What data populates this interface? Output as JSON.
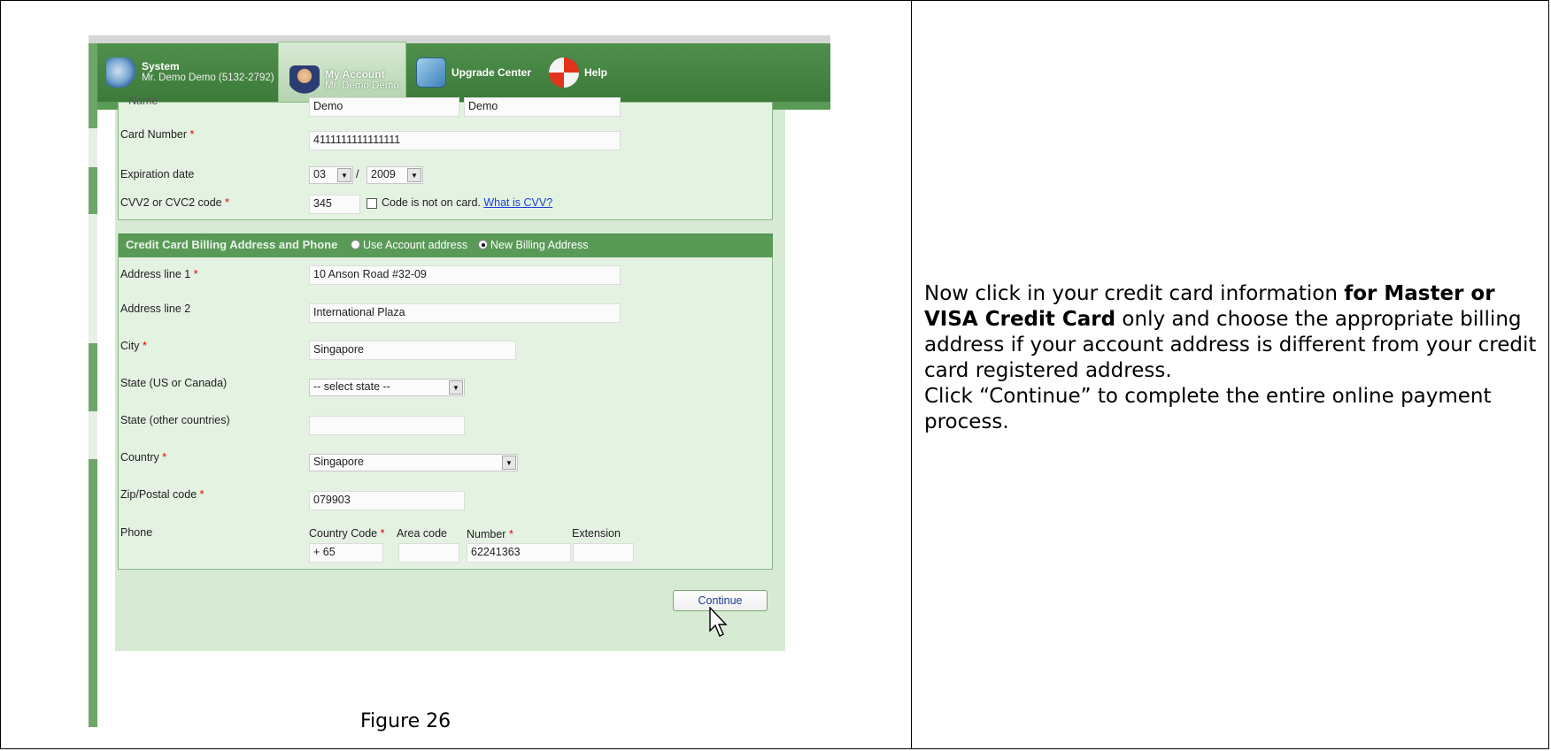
{
  "nav": {
    "system_title": "System",
    "system_sub": "Mr. Demo Demo (5132-2792)",
    "account_title": "My Account",
    "account_sub": "Mr. Demo Demo",
    "upgrade_title": "Upgrade Center",
    "help_title": "Help"
  },
  "card": {
    "name_label": "Name",
    "first_name": "Demo",
    "last_name": "Demo",
    "number_label": "Card Number",
    "number_value": "4111111111111111",
    "exp_label": "Expiration date",
    "exp_month": "03",
    "exp_sep": "/",
    "exp_year": "2009",
    "cvv_label": "CVV2 or CVC2 code",
    "cvv_value": "345",
    "cvv_check_label": "Code is not on card.",
    "cvv_link": "What is CVV?"
  },
  "billing": {
    "section_title": "Credit Card Billing Address and Phone",
    "radio_account": "Use Account address",
    "radio_new": "New Billing Address",
    "address1_label": "Address line 1",
    "address1_value": "10 Anson Road #32-09",
    "address2_label": "Address line 2",
    "address2_value": "International Plaza",
    "city_label": "City",
    "city_value": "Singapore",
    "state_label": "State (US or Canada)",
    "state_value": "-- select state --",
    "state_other_label": "State (other countries)",
    "state_other_value": "",
    "country_label": "Country",
    "country_value": "Singapore",
    "zip_label": "Zip/Postal code",
    "zip_value": "079903",
    "phone_label": "Phone",
    "country_code_label": "Country Code",
    "area_code_label": "Area code",
    "number_label": "Number",
    "extension_label": "Extension",
    "country_code_value": "+ 65",
    "area_code_value": "",
    "number_value": "62241363",
    "extension_value": ""
  },
  "continue_label": "Continue",
  "required_mark": "*",
  "caption": "Figure 26",
  "instructions": {
    "p1_pre": "Now click in your credit card information ",
    "p1_bold": "for Master or VISA Credit Card",
    "p1_post": " only and choose the appropriate billing address if your account address is different from your credit card registered address.",
    "p2": "Click “Continue” to complete the entire online payment process."
  }
}
